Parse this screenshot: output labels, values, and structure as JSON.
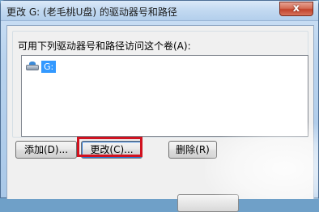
{
  "window": {
    "title": "更改 G: (老毛桃U盘) 的驱动器号和路径",
    "close_glyph": "x"
  },
  "group": {
    "label": "可用下列驱动器号和路径访问这个卷(A):"
  },
  "list": {
    "items": [
      {
        "label": "G:",
        "icon": "drive-icon",
        "selected": true
      }
    ]
  },
  "buttons": {
    "add": "添加(D)...",
    "change": "更改(C)...",
    "delete": "删除(R)"
  },
  "colors": {
    "highlight": "#d0121f",
    "selection": "#3399ff"
  }
}
